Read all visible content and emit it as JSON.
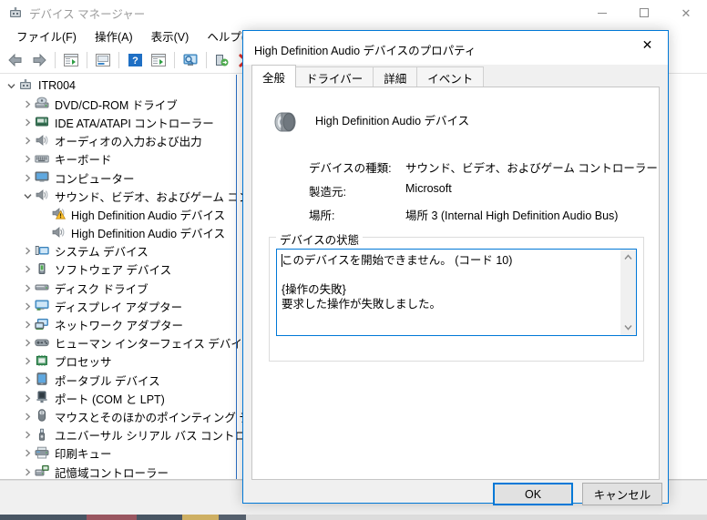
{
  "main_window": {
    "title": "デバイス マネージャー",
    "title_icon": "device-manager-icon",
    "window_controls": {
      "minimize": "minimize-icon",
      "maximize": "maximize-icon",
      "close": "close-icon"
    },
    "menu": [
      {
        "label": "ファイル(F)"
      },
      {
        "label": "操作(A)"
      },
      {
        "label": "表示(V)"
      },
      {
        "label": "ヘルプ(H)"
      }
    ],
    "toolbar": [
      {
        "name": "back-icon"
      },
      {
        "name": "forward-icon"
      },
      {
        "sep": true
      },
      {
        "name": "properties-icon"
      },
      {
        "sep": true
      },
      {
        "name": "update-driver-icon"
      },
      {
        "sep": true
      },
      {
        "name": "help-icon"
      },
      {
        "name": "scan-hardware-icon"
      },
      {
        "sep": true
      },
      {
        "name": "show-hidden-devices-icon"
      },
      {
        "sep": true
      },
      {
        "name": "uninstall-device-icon"
      },
      {
        "name": "disable-device-icon"
      },
      {
        "name": "enable-device-icon"
      }
    ],
    "tree": [
      {
        "label": "ITR004",
        "level": 0,
        "expanded": true,
        "icon": "computer-node-icon",
        "warning": false
      },
      {
        "label": "DVD/CD-ROM ドライブ",
        "level": 1,
        "expanded": false,
        "icon": "dvd-drive-icon",
        "warning": false
      },
      {
        "label": "IDE ATA/ATAPI コントローラー",
        "level": 1,
        "expanded": false,
        "icon": "ide-controller-icon",
        "warning": false
      },
      {
        "label": "オーディオの入力および出力",
        "level": 1,
        "expanded": false,
        "icon": "speaker-icon",
        "warning": false
      },
      {
        "label": "キーボード",
        "level": 1,
        "expanded": false,
        "icon": "keyboard-icon",
        "warning": false
      },
      {
        "label": "コンピューター",
        "level": 1,
        "expanded": false,
        "icon": "monitor-icon",
        "warning": false
      },
      {
        "label": "サウンド、ビデオ、およびゲーム コントローラー",
        "level": 1,
        "expanded": true,
        "icon": "speaker-icon",
        "warning": false
      },
      {
        "label": "High Definition Audio デバイス",
        "level": 2,
        "expanded": null,
        "icon": "speaker-icon",
        "warning": true
      },
      {
        "label": "High Definition Audio デバイス",
        "level": 2,
        "expanded": null,
        "icon": "speaker-icon",
        "warning": false
      },
      {
        "label": "システム デバイス",
        "level": 1,
        "expanded": false,
        "icon": "system-device-icon",
        "warning": false
      },
      {
        "label": "ソフトウェア デバイス",
        "level": 1,
        "expanded": false,
        "icon": "software-device-icon",
        "warning": false
      },
      {
        "label": "ディスク ドライブ",
        "level": 1,
        "expanded": false,
        "icon": "disk-drive-icon",
        "warning": false
      },
      {
        "label": "ディスプレイ アダプター",
        "level": 1,
        "expanded": false,
        "icon": "display-adapter-icon",
        "warning": false
      },
      {
        "label": "ネットワーク アダプター",
        "level": 1,
        "expanded": false,
        "icon": "network-adapter-icon",
        "warning": false
      },
      {
        "label": "ヒューマン インターフェイス デバイス",
        "level": 1,
        "expanded": false,
        "icon": "hid-icon",
        "warning": false
      },
      {
        "label": "プロセッサ",
        "level": 1,
        "expanded": false,
        "icon": "processor-icon",
        "warning": false
      },
      {
        "label": "ポータブル デバイス",
        "level": 1,
        "expanded": false,
        "icon": "portable-device-icon",
        "warning": false
      },
      {
        "label": "ポート (COM と LPT)",
        "level": 1,
        "expanded": false,
        "icon": "port-icon",
        "warning": false
      },
      {
        "label": "マウスとそのほかのポインティング デバイス",
        "level": 1,
        "expanded": false,
        "icon": "mouse-icon",
        "warning": false
      },
      {
        "label": "ユニバーサル シリアル バス コントローラー",
        "level": 1,
        "expanded": false,
        "icon": "usb-controller-icon",
        "warning": false
      },
      {
        "label": "印刷キュー",
        "level": 1,
        "expanded": false,
        "icon": "printer-icon",
        "warning": false
      },
      {
        "label": "記憶域コントローラー",
        "level": 1,
        "expanded": false,
        "icon": "storage-controller-icon",
        "warning": false
      }
    ]
  },
  "dialog": {
    "title": "High Definition Audio デバイスのプロパティ",
    "close_icon": "close-icon",
    "tabs": [
      {
        "label": "全般",
        "active": true
      },
      {
        "label": "ドライバー",
        "active": false
      },
      {
        "label": "詳細",
        "active": false
      },
      {
        "label": "イベント",
        "active": false
      }
    ],
    "device_icon": "speaker-icon",
    "device_name": "High Definition Audio デバイス",
    "properties": [
      {
        "label": "デバイスの種類:",
        "value": "サウンド、ビデオ、およびゲーム コントローラー"
      },
      {
        "label": "製造元:",
        "value": "Microsoft"
      },
      {
        "label": "場所:",
        "value": "場所 3 (Internal High Definition Audio Bus)"
      }
    ],
    "status_group_label": "デバイスの状態",
    "status_text": "このデバイスを開始できません。 (コード 10)\n\n{操作の失敗}\n要求した操作が失敗しました。",
    "scrollbar": {
      "up_icon": "chevron-up-icon",
      "down_icon": "chevron-down-icon"
    },
    "buttons": {
      "ok": "OK",
      "cancel": "キャンセル"
    }
  },
  "colors": {
    "accent": "#0078d7",
    "warning": "#ffc22e",
    "title_text": "#9b9b9b"
  }
}
